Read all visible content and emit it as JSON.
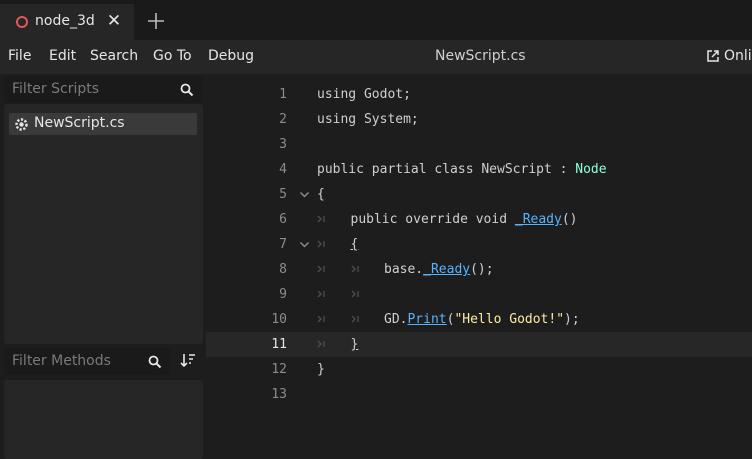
{
  "tab": {
    "label": "node_3d",
    "close": "✕"
  },
  "menu": {
    "items": [
      "File",
      "Edit",
      "Search",
      "Go To",
      "Debug"
    ],
    "title": "NewScript.cs",
    "online_docs": "Onli"
  },
  "sidebar": {
    "filter_scripts_placeholder": "Filter Scripts",
    "scripts": [
      "NewScript.cs"
    ],
    "filter_methods_placeholder": "Filter Methods"
  },
  "editor": {
    "current_line": 11,
    "line_numbers": [
      "1",
      "2",
      "3",
      "4",
      "5",
      "6",
      "7",
      "8",
      "9",
      "10",
      "11",
      "12",
      "13"
    ],
    "lines": [
      {
        "plain": "using Godot;"
      },
      {
        "plain": "using System;"
      },
      {
        "plain": ""
      },
      {
        "pre": "public partial class NewScript : ",
        "type": "Node"
      },
      {
        "plain": "{"
      },
      {
        "pre": "public override void ",
        "func": "_Ready",
        "post": "()"
      },
      {
        "plain": "{"
      },
      {
        "pre": "base.",
        "func": "_Ready",
        "post": "();"
      },
      {
        "plain": ""
      },
      {
        "pre": "GD.",
        "func": "Print",
        "mid": "(",
        "str": "\"Hello Godot!\"",
        "post": ");"
      },
      {
        "plain": "}"
      },
      {
        "plain": "}"
      },
      {
        "plain": ""
      }
    ]
  },
  "colors": {
    "accent_close": "#e0575b",
    "type": "#8fffdb",
    "func": "#57b3ff",
    "string": "#ffeda1"
  }
}
